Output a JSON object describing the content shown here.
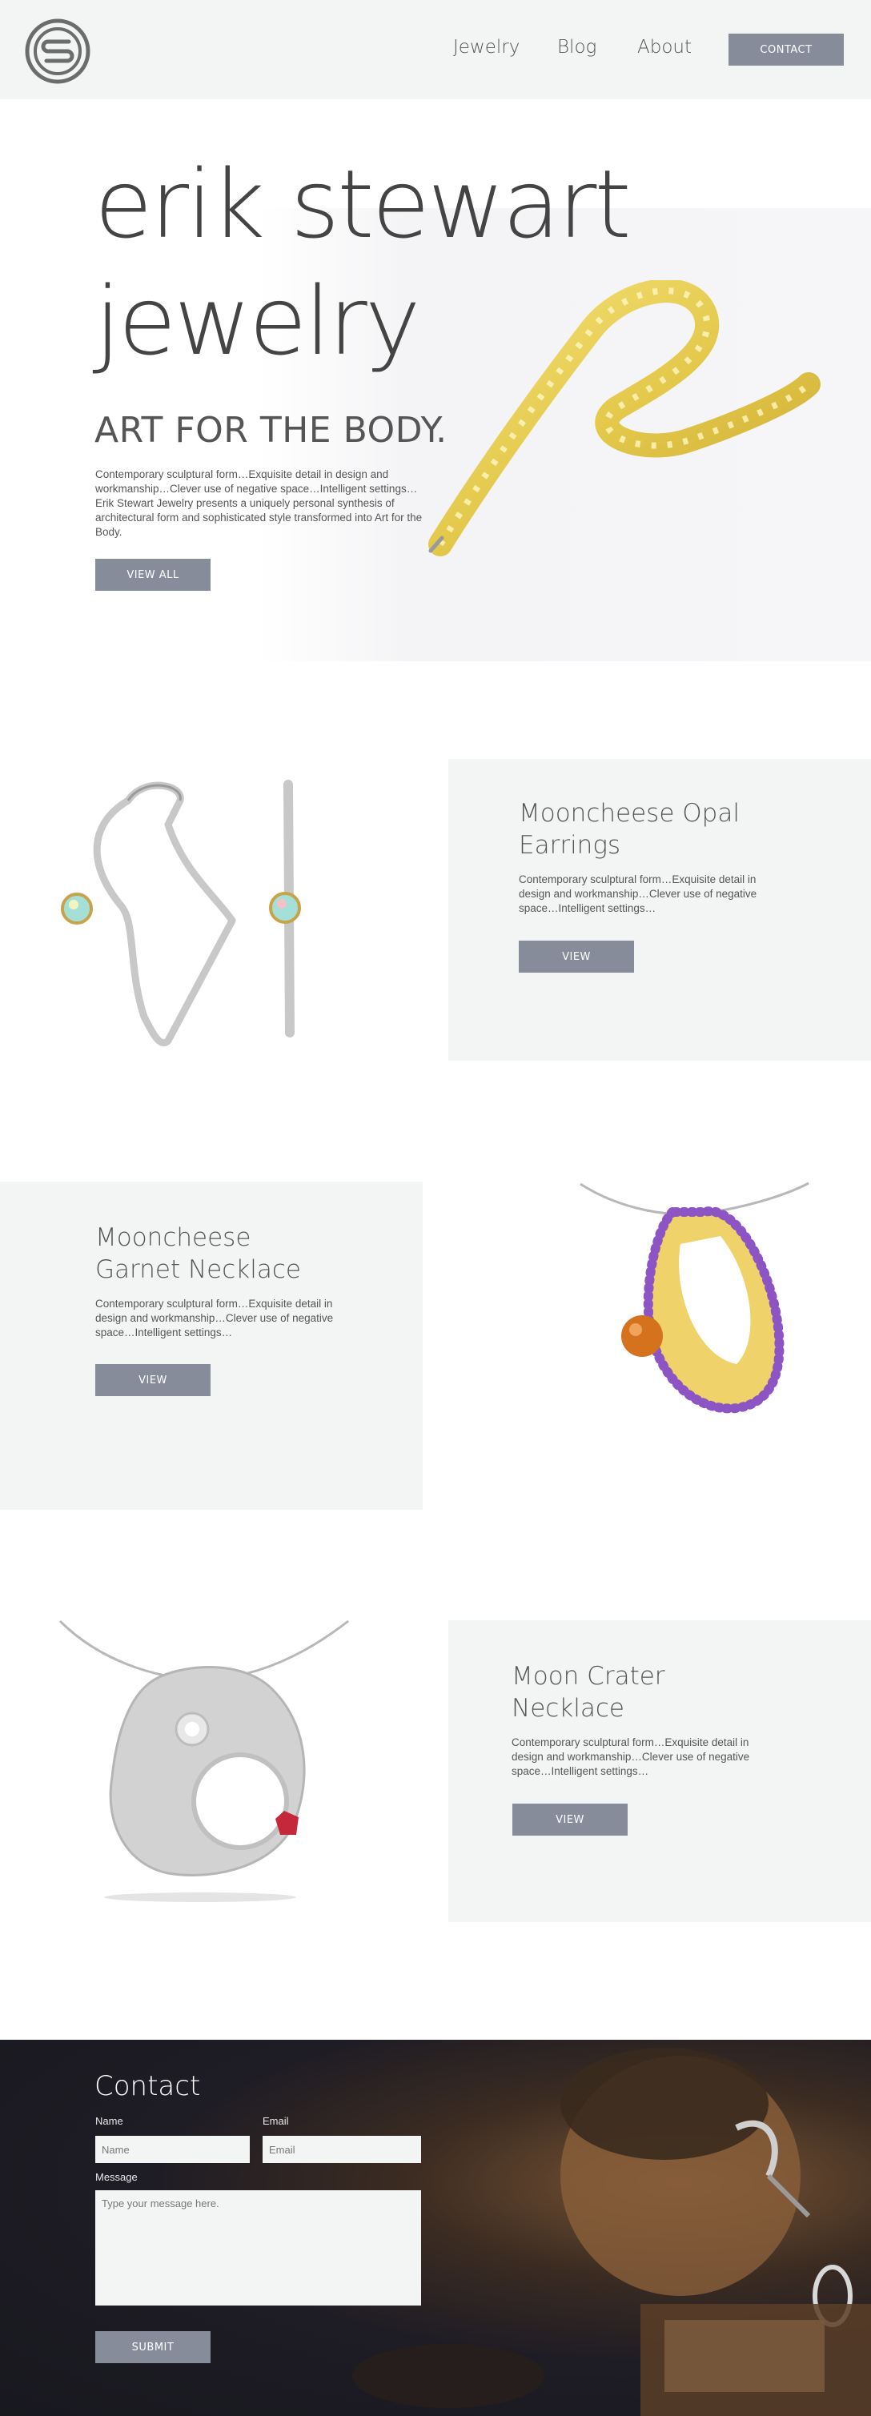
{
  "header": {
    "nav": [
      {
        "label": "Jewelry"
      },
      {
        "label": "Blog"
      },
      {
        "label": "About"
      }
    ],
    "contact_label": "CONTACT"
  },
  "hero": {
    "title_line1": "erik stewart",
    "title_line2": "jewelry",
    "subtitle": "ART FOR THE BODY.",
    "description": "Contemporary sculptural form…Exquisite detail in design and workmanship…Clever use of negative space…Intelligent settings…Erik Stewart Jewelry presents a uniquely personal synthesis of architectural form and sophisticated style transformed into Art for the Body.",
    "button_label": "VIEW ALL"
  },
  "products": [
    {
      "title_line1": "Mooncheese Opal",
      "title_line2": "Earrings",
      "description": "Contemporary sculptural form…Exquisite detail in design and workmanship…Clever use of negative space…Intelligent settings…",
      "button_label": "VIEW"
    },
    {
      "title_line1": "Mooncheese",
      "title_line2": "Garnet Necklace",
      "description": "Contemporary sculptural form…Exquisite detail in design and workmanship…Clever use of negative space…Intelligent settings…",
      "button_label": "VIEW"
    },
    {
      "title_line1": "Moon Crater",
      "title_line2": "Necklace",
      "description": "Contemporary sculptural form…Exquisite detail in design and workmanship…Clever use of negative space…Intelligent settings…",
      "button_label": "VIEW"
    }
  ],
  "contact": {
    "title": "Contact",
    "name_label": "Name",
    "name_placeholder": "Name",
    "email_label": "Email",
    "email_placeholder": "Email",
    "message_label": "Message",
    "message_placeholder": "Type your message here.",
    "submit_label": "SUBMIT"
  },
  "colors": {
    "header_bg": "#f3f4f4",
    "button": "#878c9a",
    "panel_bg": "#f3f4f4",
    "gold": "#e3c84a",
    "contact_bg": "#1e1c24"
  },
  "icons": [
    "logo-icon"
  ]
}
